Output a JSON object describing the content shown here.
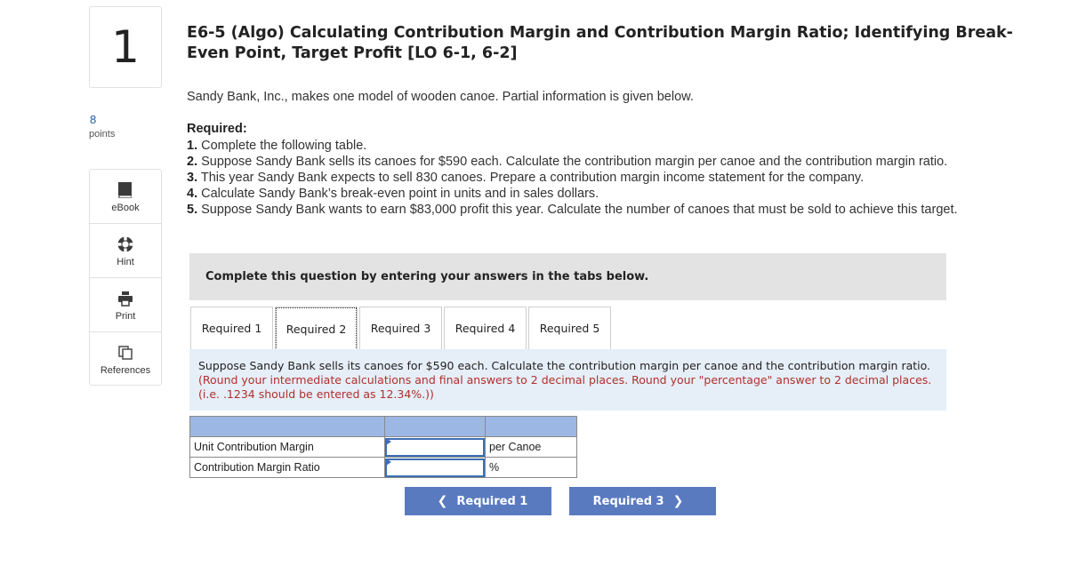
{
  "question": {
    "number": "1",
    "points_value": "8",
    "points_label": "points"
  },
  "tools": [
    {
      "label": "eBook",
      "icon": "book-icon"
    },
    {
      "label": "Hint",
      "icon": "lifebuoy-icon"
    },
    {
      "label": "Print",
      "icon": "printer-icon"
    },
    {
      "label": "References",
      "icon": "copy-icon"
    }
  ],
  "title": "E6-5 (Algo) Calculating Contribution Margin and Contribution Margin Ratio; Identifying Break-Even Point, Target Profit [LO 6-1, 6-2]",
  "intro": "Sandy Bank, Inc., makes one model of wooden canoe. Partial information is given below.",
  "required_heading": "Required:",
  "required_items": [
    {
      "num": "1.",
      "text": "Complete the following table."
    },
    {
      "num": "2.",
      "text": "Suppose Sandy Bank sells its canoes for $590 each. Calculate the contribution margin per canoe and the contribution margin ratio."
    },
    {
      "num": "3.",
      "text": "This year Sandy Bank expects to sell 830 canoes. Prepare a contribution margin income statement for the company."
    },
    {
      "num": "4.",
      "text": "Calculate Sandy Bank’s break-even point in units and in sales dollars."
    },
    {
      "num": "5.",
      "text": "Suppose Sandy Bank wants to earn $83,000 profit this year. Calculate the number of canoes that must be sold to achieve this target."
    }
  ],
  "banner": "Complete this question by entering your answers in the tabs below.",
  "tabs": [
    "Required 1",
    "Required 2",
    "Required 3",
    "Required 4",
    "Required 5"
  ],
  "active_tab": "Required 2",
  "panel": {
    "text": "Suppose Sandy Bank sells its canoes for $590 each. Calculate the contribution margin per canoe and the contribution margin ratio.",
    "note": "(Round your intermediate calculations and final answers to 2 decimal places. Round your \"percentage\" answer to 2 decimal places. (i.e. .1234 should be entered as 12.34%.))"
  },
  "table": {
    "rows": [
      {
        "label": "Unit Contribution Margin",
        "value": "",
        "unit": "per Canoe"
      },
      {
        "label": "Contribution Margin Ratio",
        "value": "",
        "unit": "%"
      }
    ]
  },
  "nav": {
    "prev": "Required 1",
    "next": "Required 3"
  },
  "colors": {
    "header_row": "#9cb7e4",
    "panel_bg": "#e6eef8",
    "button_bg": "#5a7ac0",
    "note_red": "#b0302b"
  }
}
